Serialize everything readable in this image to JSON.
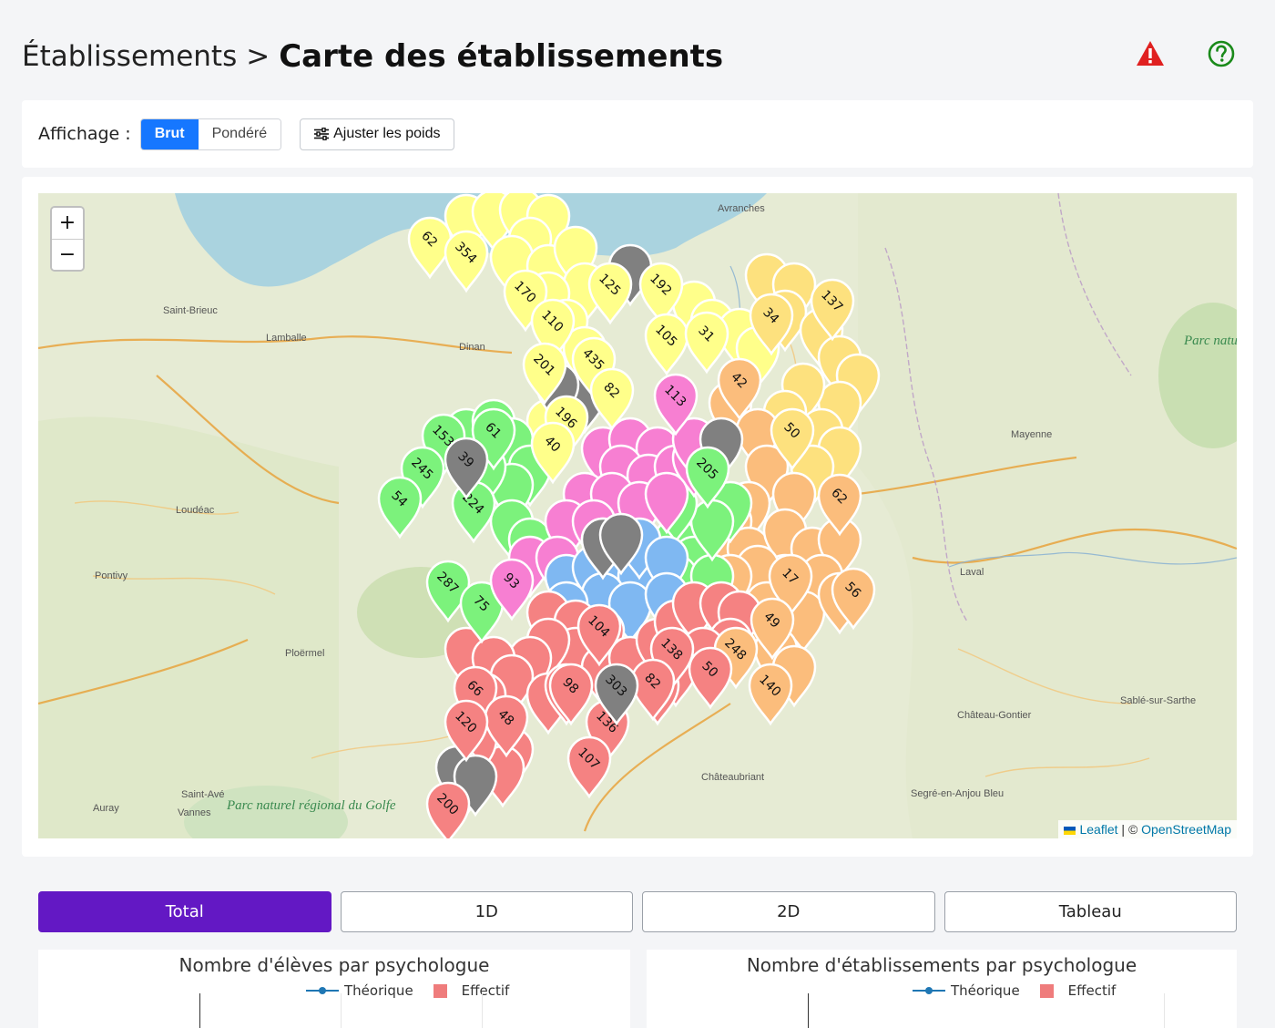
{
  "header": {
    "breadcrumb_parent": "Établissements",
    "breadcrumb_sep": ">",
    "breadcrumb_current": "Carte des établissements",
    "alert_icon": "warning-triangle-icon",
    "help_icon": "help-circle-icon"
  },
  "toolbar": {
    "label": "Affichage :",
    "options": [
      "Brut",
      "Pondéré"
    ],
    "selected": "Brut",
    "weights_button": "Ajuster les poids"
  },
  "map": {
    "zoom_in": "+",
    "zoom_out": "−",
    "attribution_leaflet": "Leaflet",
    "attribution_sep": "| ©",
    "attribution_osm": "OpenStreetMap",
    "towns": [
      "Avranches",
      "Saint-Brieuc",
      "Lamballe",
      "Dinan",
      "Loudéac",
      "Pontivy",
      "Ploërmel",
      "Mayenne",
      "Laval",
      "Château-Gontier",
      "Sablé-sur-Sarthe",
      "Châteaubriant",
      "Segré-en-Anjou Bleu",
      "Saint-Avé",
      "Vannes",
      "Auray"
    ],
    "parks": [
      "Parc naturel régional du Golfe",
      "Parc naturel régional Normandie-Maine"
    ],
    "marker_colors": {
      "yellow": "#ffff8a",
      "green": "#7cf27c",
      "pink": "#f77fd2",
      "blue": "#7fb8f2",
      "red": "#f58282",
      "orange": "#fbbd7c",
      "gold": "#fde17e",
      "gray": "#808080"
    },
    "markers": [
      {
        "label": "62",
        "color": "yellow"
      },
      {
        "label": "354",
        "color": "yellow"
      },
      {
        "label": "170",
        "color": "yellow"
      },
      {
        "label": "110",
        "color": "yellow"
      },
      {
        "label": "201",
        "color": "yellow"
      },
      {
        "label": "435",
        "color": "yellow"
      },
      {
        "label": "82",
        "color": "yellow"
      },
      {
        "label": "196",
        "color": "yellow"
      },
      {
        "label": "125",
        "color": "yellow"
      },
      {
        "label": "192",
        "color": "yellow"
      },
      {
        "label": "105",
        "color": "yellow"
      },
      {
        "label": "31",
        "color": "yellow"
      },
      {
        "label": "40",
        "color": "yellow"
      },
      {
        "label": "137",
        "color": "gold"
      },
      {
        "label": "34",
        "color": "gold"
      },
      {
        "label": "50",
        "color": "gold"
      },
      {
        "label": "42",
        "color": "orange"
      },
      {
        "label": "62",
        "color": "orange"
      },
      {
        "label": "56",
        "color": "orange"
      },
      {
        "label": "17",
        "color": "orange"
      },
      {
        "label": "49",
        "color": "orange"
      },
      {
        "label": "248",
        "color": "orange"
      },
      {
        "label": "140",
        "color": "orange"
      },
      {
        "label": "153",
        "color": "green"
      },
      {
        "label": "61",
        "color": "green"
      },
      {
        "label": "245",
        "color": "green"
      },
      {
        "label": "54",
        "color": "green"
      },
      {
        "label": "224",
        "color": "green"
      },
      {
        "label": "287",
        "color": "green"
      },
      {
        "label": "75",
        "color": "green"
      },
      {
        "label": "205",
        "color": "green"
      },
      {
        "label": "113",
        "color": "pink"
      },
      {
        "label": "93",
        "color": "pink"
      },
      {
        "label": "104",
        "color": "red"
      },
      {
        "label": "138",
        "color": "red"
      },
      {
        "label": "50",
        "color": "red"
      },
      {
        "label": "82",
        "color": "red"
      },
      {
        "label": "98",
        "color": "red"
      },
      {
        "label": "66",
        "color": "red"
      },
      {
        "label": "48",
        "color": "red"
      },
      {
        "label": "120",
        "color": "red"
      },
      {
        "label": "136",
        "color": "red"
      },
      {
        "label": "107",
        "color": "red"
      },
      {
        "label": "200",
        "color": "red"
      },
      {
        "label": "303",
        "color": "gray"
      },
      {
        "label": "39",
        "color": "gray"
      }
    ]
  },
  "tabs": [
    {
      "label": "Total",
      "active": true
    },
    {
      "label": "1D",
      "active": false
    },
    {
      "label": "2D",
      "active": false
    },
    {
      "label": "Tableau",
      "active": false
    }
  ],
  "charts": [
    {
      "title": "Nombre d'élèves par psychologue",
      "legend": [
        "Théorique",
        "Effectif"
      ]
    },
    {
      "title": "Nombre d'établissements par psychologue",
      "legend": [
        "Théorique",
        "Effectif"
      ]
    }
  ],
  "colors": {
    "accent": "#1677ff",
    "tab_active": "#6318c4",
    "alert": "#e02020",
    "help": "#1a8a1a",
    "theoretical": "#1f77b4",
    "effective": "#ef7c7c"
  }
}
